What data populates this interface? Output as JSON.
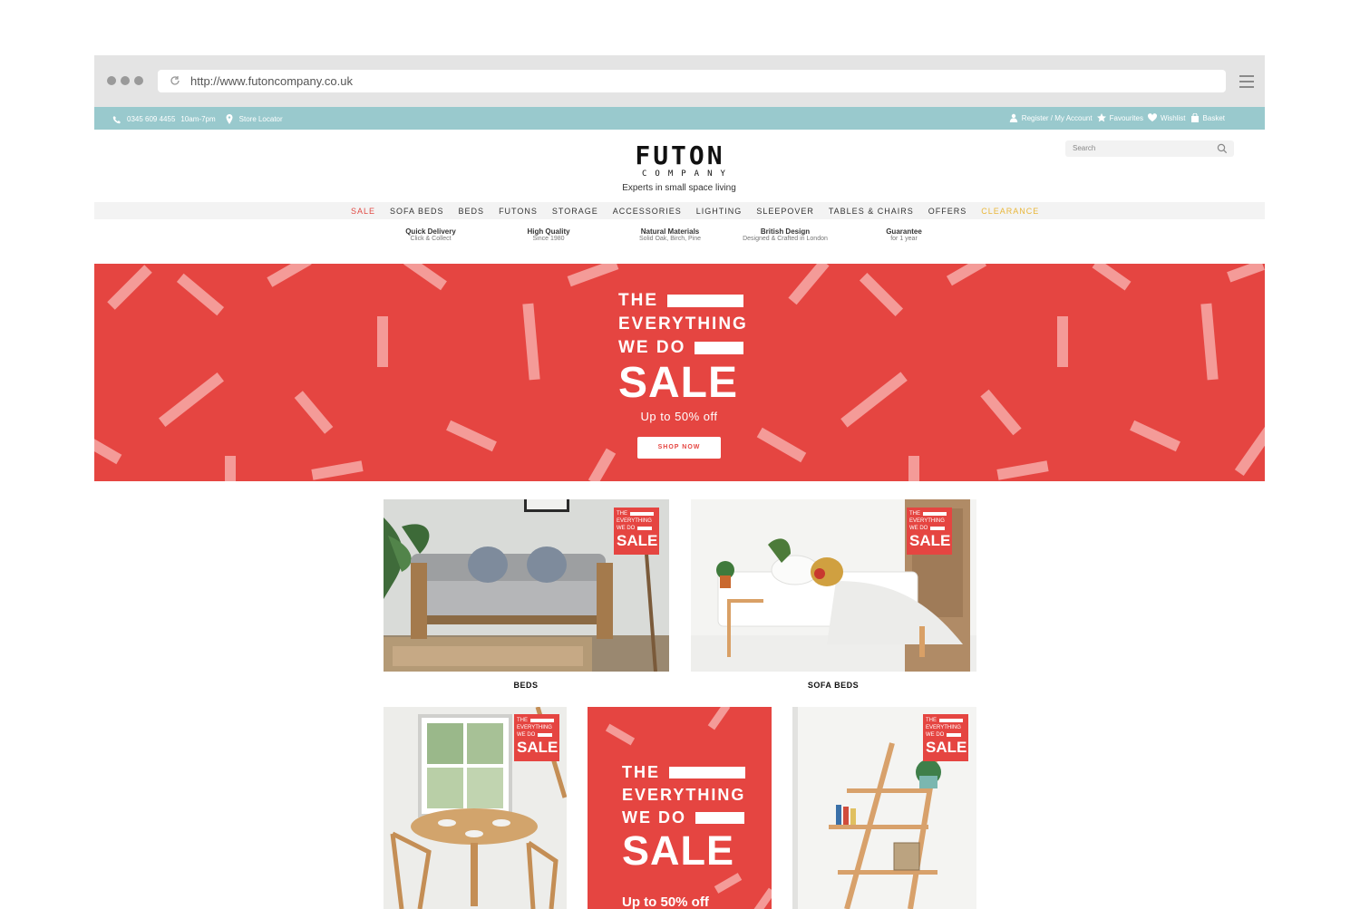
{
  "browser": {
    "url": "http://www.futoncompany.co.uk"
  },
  "topbar": {
    "phone": "0345 609 4455",
    "hours": "10am-7pm",
    "store_locator": "Store Locator",
    "account": "Register / My Account",
    "favourites": "Favourites",
    "wishlist": "Wishlist",
    "basket": "Basket"
  },
  "header": {
    "logo_main": "FUTON",
    "logo_sub": "COMPANY",
    "tagline": "Experts in small space living",
    "search_placeholder": "Search"
  },
  "nav": {
    "items": [
      "SALE",
      "SOFA BEDS",
      "BEDS",
      "FUTONS",
      "STORAGE",
      "ACCESSORIES",
      "LIGHTING",
      "SLEEPOVER",
      "TABLES & CHAIRS",
      "OFFERS",
      "CLEARANCE"
    ]
  },
  "usps": [
    {
      "title": "Quick Delivery",
      "sub": "Click & Collect"
    },
    {
      "title": "High Quality",
      "sub": "Since 1980"
    },
    {
      "title": "Natural Materials",
      "sub": "Solid Oak, Birch, Pine"
    },
    {
      "title": "British Design",
      "sub": "Designed & Crafted in London"
    },
    {
      "title": "Guarantee",
      "sub": "for 1 year"
    }
  ],
  "hero": {
    "line1": "THE",
    "line2": "EVERYTHING",
    "line3": "WE DO",
    "line4": "SALE",
    "subtitle": "Up to 50% off",
    "cta": "SHOP NOW"
  },
  "badge": {
    "line1": "THE",
    "line2": "EVERYTHING",
    "line3": "WE DO",
    "line4": "SALE"
  },
  "tiles": {
    "beds_caption": "BEDS",
    "sofabeds_caption": "SOFA BEDS"
  },
  "sale_card": {
    "line1": "THE",
    "line2": "EVERYTHING",
    "line3": "WE DO",
    "line4": "SALE",
    "subtitle": "Up to 50% off"
  },
  "colors": {
    "brand_red": "#e54541",
    "topbar_teal": "#99c9cd",
    "clearance_yellow": "#e9b73a"
  }
}
